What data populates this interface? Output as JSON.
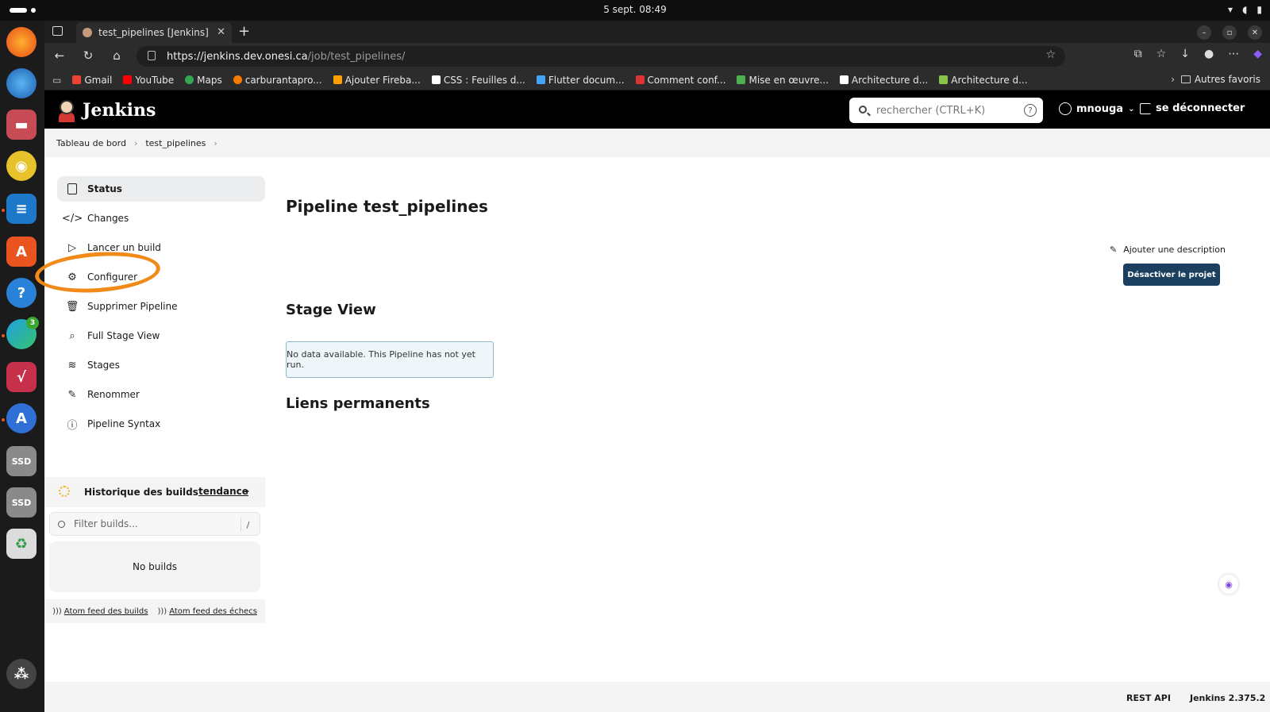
{
  "system": {
    "clock": "5 sept.  08:49"
  },
  "browser": {
    "tab_title": "test_pipelines [Jenkins]",
    "url_host": "https://jenkins.dev.onesi.ca",
    "url_path": "/job/test_pipelines/",
    "bookmarks": [
      "Gmail",
      "YouTube",
      "Maps",
      "carburantapro...",
      "Ajouter Fireba...",
      "CSS : Feuilles d...",
      "Flutter docum...",
      "Comment conf...",
      "Mise en œuvre...",
      "Architecture d...",
      "Architecture d..."
    ],
    "other_bookmarks": "Autres favoris"
  },
  "jenkins": {
    "brand": "Jenkins",
    "search_placeholder": "rechercher (CTRL+K)",
    "user": "mnouga",
    "logout": "se déconnecter",
    "breadcrumb": [
      "Tableau de bord",
      "test_pipelines"
    ]
  },
  "sidebar": {
    "items": [
      {
        "label": "Status",
        "icon": "document-icon"
      },
      {
        "label": "Changes",
        "icon": "code-icon"
      },
      {
        "label": "Lancer un build",
        "icon": "play-icon"
      },
      {
        "label": "Configurer",
        "icon": "gear-icon"
      },
      {
        "label": "Supprimer Pipeline",
        "icon": "trash-icon"
      },
      {
        "label": "Full Stage View",
        "icon": "search-icon"
      },
      {
        "label": "Stages",
        "icon": "layers-icon"
      },
      {
        "label": "Renommer",
        "icon": "pencil-icon"
      },
      {
        "label": "Pipeline Syntax",
        "icon": "help-icon"
      }
    ],
    "history_title": "Historique des builds",
    "history_trend": "tendance",
    "filter_placeholder": "Filter builds...",
    "filter_shortcut": "/",
    "no_builds": "No builds",
    "feed_all": "Atom feed des builds",
    "feed_failures": "Atom feed des échecs"
  },
  "main": {
    "title": "Pipeline test_pipelines",
    "add_description": "Ajouter une description",
    "disable_button": "Désactiver le projet",
    "stage_view_title": "Stage View",
    "no_data": "No data available. This Pipeline has not yet run.",
    "permalinks_title": "Liens permanents"
  },
  "footer": {
    "rest_api": "REST API",
    "version": "Jenkins 2.375.2"
  },
  "colors": {
    "accent_button": "#1b3f5f",
    "annotation": "#f28a1a",
    "header_bg": "#000000"
  }
}
